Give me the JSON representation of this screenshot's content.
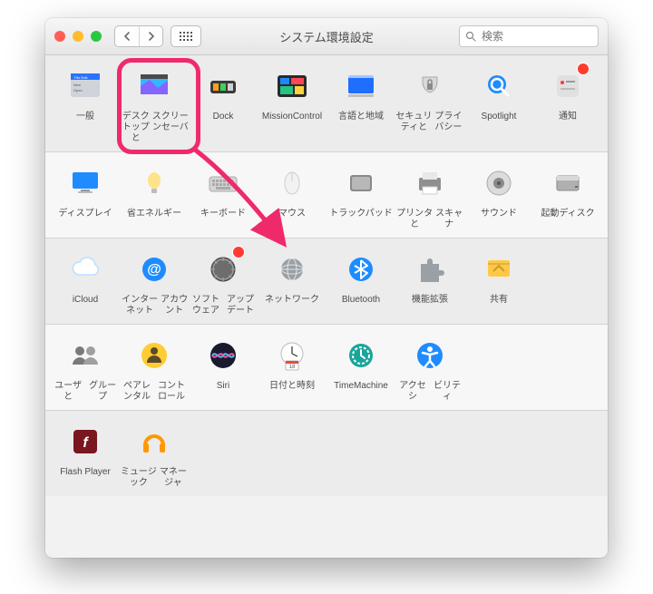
{
  "window": {
    "title": "システム環境設定",
    "search_placeholder": "検索"
  },
  "rows": [
    [
      {
        "id": "general",
        "label": "一般"
      },
      {
        "id": "desktop",
        "label": "デスクトップと\nスクリーンセーバ"
      },
      {
        "id": "dock",
        "label": "Dock"
      },
      {
        "id": "mission",
        "label": "Mission\nControl"
      },
      {
        "id": "lang",
        "label": "言語と地域"
      },
      {
        "id": "security",
        "label": "セキュリティと\nプライバシー"
      },
      {
        "id": "spotlight",
        "label": "Spotlight"
      },
      {
        "id": "notifications",
        "label": "通知"
      }
    ],
    [
      {
        "id": "displays",
        "label": "ディスプレイ"
      },
      {
        "id": "energy",
        "label": "省エネルギー"
      },
      {
        "id": "keyboard",
        "label": "キーボード"
      },
      {
        "id": "mouse",
        "label": "マウス"
      },
      {
        "id": "trackpad",
        "label": "トラックパッド"
      },
      {
        "id": "printers",
        "label": "プリンタと\nスキャナ"
      },
      {
        "id": "sound",
        "label": "サウンド"
      },
      {
        "id": "startup",
        "label": "起動ディスク"
      }
    ],
    [
      {
        "id": "icloud",
        "label": "iCloud"
      },
      {
        "id": "internet",
        "label": "インターネット\nアカウント"
      },
      {
        "id": "software",
        "label": "ソフトウェア\nアップデート"
      },
      {
        "id": "network",
        "label": "ネットワーク"
      },
      {
        "id": "bluetooth",
        "label": "Bluetooth"
      },
      {
        "id": "extensions",
        "label": "機能拡張"
      },
      {
        "id": "sharing",
        "label": "共有"
      }
    ],
    [
      {
        "id": "users",
        "label": "ユーザと\nグループ"
      },
      {
        "id": "parental",
        "label": "ペアレンタル\nコントロール"
      },
      {
        "id": "siri",
        "label": "Siri"
      },
      {
        "id": "datetime",
        "label": "日付と時刻"
      },
      {
        "id": "timemachine",
        "label": "Time\nMachine"
      },
      {
        "id": "accessibility",
        "label": "アクセシ\nビリティ"
      }
    ],
    [
      {
        "id": "flash",
        "label": "Flash Player"
      },
      {
        "id": "music",
        "label": "ミュージック\nマネージャ"
      }
    ]
  ],
  "badges": {
    "notifications": true,
    "software": true
  },
  "annotation": {
    "highlighted": "desktop"
  }
}
